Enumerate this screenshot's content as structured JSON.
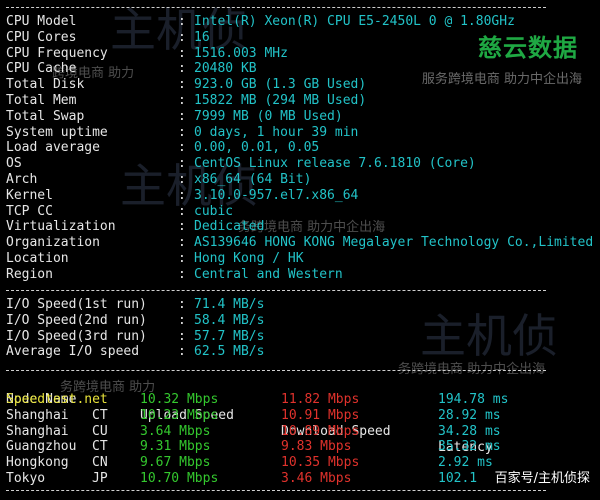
{
  "watermarks": {
    "brand_name": "慈云数据",
    "brand_tagline": "服务跨境电商 助力中企出海",
    "tagline_mid": "跨境电商 助力",
    "tagline_mid2": "务跨境电商 助力中企出海",
    "tagline_low": "务跨境电商 助力",
    "big_mark": "主机侦",
    "credit": "百家号/主机侦探"
  },
  "system_info": [
    {
      "label": "CPU Model",
      "value": "Intel(R) Xeon(R) CPU E5-2450L 0 @ 1.80GHz"
    },
    {
      "label": "CPU Cores",
      "value": "16"
    },
    {
      "label": "CPU Frequency",
      "value": "1516.003 MHz"
    },
    {
      "label": "CPU Cache",
      "value": "20480 KB"
    },
    {
      "label": "Total Disk",
      "value": "923.0 GB (1.3 GB Used)"
    },
    {
      "label": "Total Mem",
      "value": "15822 MB (294 MB Used)"
    },
    {
      "label": "Total Swap",
      "value": "7999 MB (0 MB Used)"
    },
    {
      "label": "System uptime",
      "value": "0 days, 1 hour 39 min"
    },
    {
      "label": "Load average",
      "value": "0.00, 0.01, 0.05"
    },
    {
      "label": "OS",
      "value": "CentOS Linux release 7.6.1810 (Core)"
    },
    {
      "label": "Arch",
      "value": "x86_64 (64 Bit)"
    },
    {
      "label": "Kernel",
      "value": "3.10.0-957.el7.x86_64"
    },
    {
      "label": "TCP CC",
      "value": "cubic"
    },
    {
      "label": "Virtualization",
      "value": "Dedicated"
    },
    {
      "label": "Organization",
      "value": "AS139646 HONG KONG Megalayer Technology Co.,Limited"
    },
    {
      "label": "Location",
      "value": "Hong Kong / HK"
    },
    {
      "label": "Region",
      "value": "Central and Western"
    }
  ],
  "io_speed": [
    {
      "label": "I/O Speed(1st run)",
      "value": "71.4 MB/s"
    },
    {
      "label": "I/O Speed(2nd run)",
      "value": "58.4 MB/s"
    },
    {
      "label": "I/O Speed(3rd run)",
      "value": "57.7 MB/s"
    },
    {
      "label": "Average I/O speed",
      "value": "62.5 MB/s"
    }
  ],
  "speedtest": {
    "headers": {
      "node": "Node Name",
      "upload": "Upload Speed",
      "download": "Download Speed",
      "latency": "Latency"
    },
    "rows": [
      {
        "node": "Speedtest.net",
        "code": "",
        "upload": "10.32 Mbps",
        "download": "11.82 Mbps",
        "latency": "194.78 ms"
      },
      {
        "node": "Shanghai",
        "code": "CT",
        "upload": "10.23 Mbps",
        "download": "10.91 Mbps",
        "latency": "28.92 ms"
      },
      {
        "node": "Shanghai",
        "code": "CU",
        "upload": "3.64 Mbps",
        "download": "10.89 Mbps",
        "latency": "34.28 ms"
      },
      {
        "node": "Guangzhou",
        "code": "CT",
        "upload": "9.31 Mbps",
        "download": "9.83 Mbps",
        "latency": "35.32 ms"
      },
      {
        "node": "Hongkong",
        "code": "CN",
        "upload": "9.67 Mbps",
        "download": "10.35 Mbps",
        "latency": "2.92 ms"
      },
      {
        "node": "Tokyo",
        "code": "JP",
        "upload": "10.70 Mbps",
        "download": "3.46 Mbps",
        "latency": "102.1"
      }
    ]
  },
  "colors": {
    "background": "#000000",
    "label": "#e6e6e6",
    "value": "#22c3c8",
    "upload": "#34c82e",
    "download": "#e0322c",
    "first_node": "#e8e33a"
  }
}
